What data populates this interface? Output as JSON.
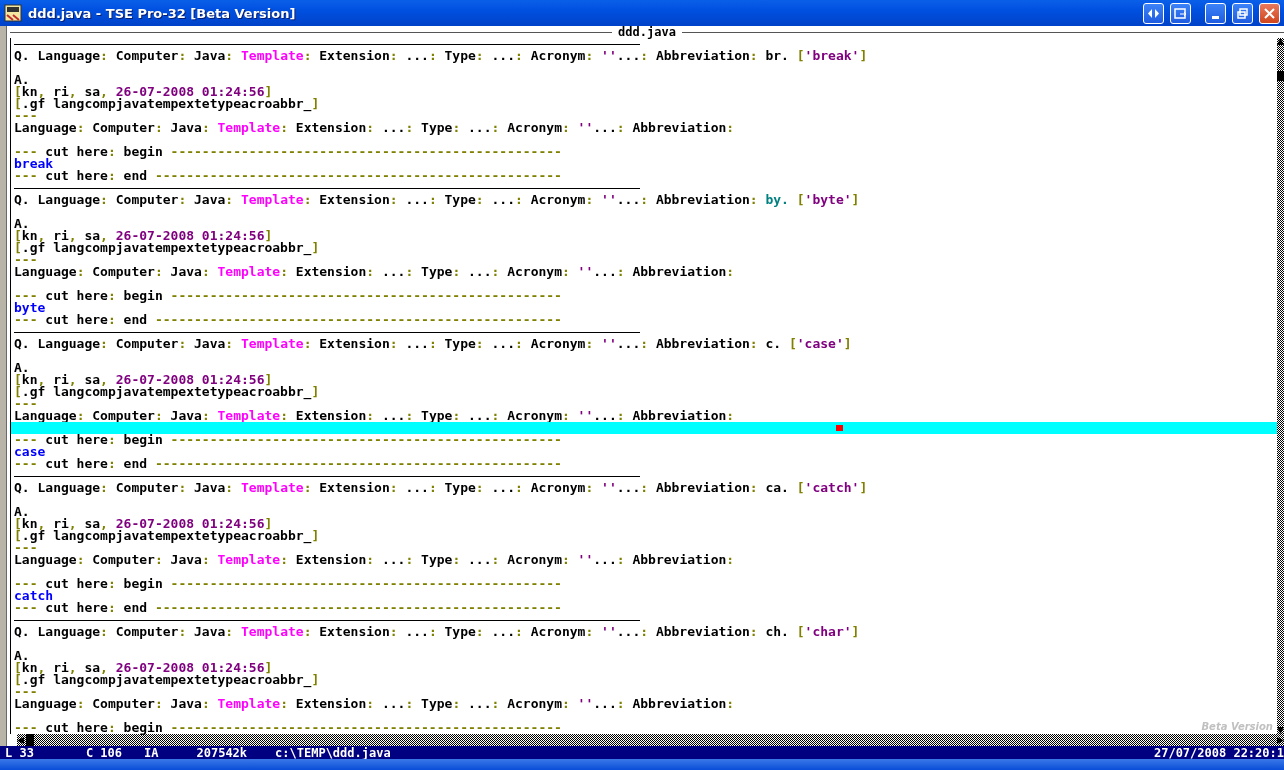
{
  "window": {
    "title": "ddd.java - TSE Pro-32 [Beta Version]"
  },
  "editor": {
    "file_tab": "ddd.java",
    "beta_label": "Beta Version",
    "lines": [
      {
        "kind": "rule"
      },
      {
        "kind": "text",
        "spans": [
          {
            "kind": "plain",
            "text": "Q. Language"
          },
          {
            "kind": "punct",
            "text": ":"
          },
          {
            "kind": "plain",
            "text": " Computer"
          },
          {
            "kind": "punct",
            "text": ":"
          },
          {
            "kind": "plain",
            "text": " Java"
          },
          {
            "kind": "punct",
            "text": ":"
          },
          {
            "kind": "magenta",
            "text": " Template"
          },
          {
            "kind": "punct",
            "text": ":"
          },
          {
            "kind": "plain",
            "text": " Extension"
          },
          {
            "kind": "punct",
            "text": ":"
          },
          {
            "kind": "plain",
            "text": " ..."
          },
          {
            "kind": "punct",
            "text": ":"
          },
          {
            "kind": "plain",
            "text": " Type"
          },
          {
            "kind": "punct",
            "text": ":"
          },
          {
            "kind": "plain",
            "text": " ..."
          },
          {
            "kind": "punct",
            "text": ":"
          },
          {
            "kind": "plain",
            "text": " Acronym"
          },
          {
            "kind": "punct",
            "text": ":"
          },
          {
            "kind": "purple",
            "text": " ''"
          },
          {
            "kind": "plain",
            "text": "..."
          },
          {
            "kind": "punct",
            "text": ":"
          },
          {
            "kind": "plain",
            "text": " Abbreviation"
          },
          {
            "kind": "punct",
            "text": ":"
          },
          {
            "kind": "plain",
            "text": " br."
          },
          {
            "kind": "punct",
            "text": " ["
          },
          {
            "kind": "purple",
            "text": "'break'"
          },
          {
            "kind": "punct",
            "text": "]"
          }
        ]
      },
      {
        "kind": "blank"
      },
      {
        "kind": "text",
        "spans": [
          {
            "kind": "plain",
            "text": "A."
          }
        ]
      },
      {
        "kind": "text",
        "spans": [
          {
            "kind": "punct",
            "text": "["
          },
          {
            "kind": "plain",
            "text": "kn"
          },
          {
            "kind": "punct",
            "text": ","
          },
          {
            "kind": "plain",
            "text": " ri"
          },
          {
            "kind": "punct",
            "text": ","
          },
          {
            "kind": "plain",
            "text": " sa"
          },
          {
            "kind": "punct",
            "text": ","
          },
          {
            "kind": "purple",
            "text": " 26-07-2008 01:24:56"
          },
          {
            "kind": "punct",
            "text": "]"
          }
        ]
      },
      {
        "kind": "text",
        "spans": [
          {
            "kind": "punct",
            "text": "["
          },
          {
            "kind": "plain",
            "text": ".gf langcompjavatempextetypeacroabbr_"
          },
          {
            "kind": "punct",
            "text": "]"
          }
        ]
      },
      {
        "kind": "text",
        "spans": [
          {
            "kind": "punct",
            "text": "---"
          }
        ]
      },
      {
        "kind": "text",
        "spans": [
          {
            "kind": "plain",
            "text": "Language"
          },
          {
            "kind": "punct",
            "text": ":"
          },
          {
            "kind": "plain",
            "text": " Computer"
          },
          {
            "kind": "punct",
            "text": ":"
          },
          {
            "kind": "plain",
            "text": " Java"
          },
          {
            "kind": "punct",
            "text": ":"
          },
          {
            "kind": "magenta",
            "text": " Template"
          },
          {
            "kind": "punct",
            "text": ":"
          },
          {
            "kind": "plain",
            "text": " Extension"
          },
          {
            "kind": "punct",
            "text": ":"
          },
          {
            "kind": "plain",
            "text": " ..."
          },
          {
            "kind": "punct",
            "text": ":"
          },
          {
            "kind": "plain",
            "text": " Type"
          },
          {
            "kind": "punct",
            "text": ":"
          },
          {
            "kind": "plain",
            "text": " ..."
          },
          {
            "kind": "punct",
            "text": ":"
          },
          {
            "kind": "plain",
            "text": " Acronym"
          },
          {
            "kind": "punct",
            "text": ":"
          },
          {
            "kind": "purple",
            "text": " ''"
          },
          {
            "kind": "plain",
            "text": "..."
          },
          {
            "kind": "punct",
            "text": ":"
          },
          {
            "kind": "plain",
            "text": " Abbreviation"
          },
          {
            "kind": "punct",
            "text": ":"
          }
        ]
      },
      {
        "kind": "blank"
      },
      {
        "kind": "text",
        "spans": [
          {
            "kind": "punct",
            "text": "---"
          },
          {
            "kind": "plain",
            "text": " cut here"
          },
          {
            "kind": "punct",
            "text": ":"
          },
          {
            "kind": "plain",
            "text": " begin"
          },
          {
            "kind": "punct",
            "text": " --------------------------------------------------"
          }
        ]
      },
      {
        "kind": "text",
        "spans": [
          {
            "kind": "keyword",
            "text": "break"
          }
        ]
      },
      {
        "kind": "text",
        "spans": [
          {
            "kind": "punct",
            "text": "---"
          },
          {
            "kind": "plain",
            "text": " cut here"
          },
          {
            "kind": "punct",
            "text": ":"
          },
          {
            "kind": "plain",
            "text": " end"
          },
          {
            "kind": "punct",
            "text": " ----------------------------------------------------"
          }
        ]
      },
      {
        "kind": "rule"
      },
      {
        "kind": "text",
        "spans": [
          {
            "kind": "plain",
            "text": "Q. Language"
          },
          {
            "kind": "punct",
            "text": ":"
          },
          {
            "kind": "plain",
            "text": " Computer"
          },
          {
            "kind": "punct",
            "text": ":"
          },
          {
            "kind": "plain",
            "text": " Java"
          },
          {
            "kind": "punct",
            "text": ":"
          },
          {
            "kind": "magenta",
            "text": " Template"
          },
          {
            "kind": "punct",
            "text": ":"
          },
          {
            "kind": "plain",
            "text": " Extension"
          },
          {
            "kind": "punct",
            "text": ":"
          },
          {
            "kind": "plain",
            "text": " ..."
          },
          {
            "kind": "punct",
            "text": ":"
          },
          {
            "kind": "plain",
            "text": " Type"
          },
          {
            "kind": "punct",
            "text": ":"
          },
          {
            "kind": "plain",
            "text": " ..."
          },
          {
            "kind": "punct",
            "text": ":"
          },
          {
            "kind": "plain",
            "text": " Acronym"
          },
          {
            "kind": "punct",
            "text": ":"
          },
          {
            "kind": "purple",
            "text": " ''"
          },
          {
            "kind": "plain",
            "text": "..."
          },
          {
            "kind": "punct",
            "text": ":"
          },
          {
            "kind": "plain",
            "text": " Abbreviation"
          },
          {
            "kind": "punct",
            "text": ":"
          },
          {
            "kind": "teal",
            "text": " by."
          },
          {
            "kind": "punct",
            "text": " ["
          },
          {
            "kind": "purple",
            "text": "'byte'"
          },
          {
            "kind": "punct",
            "text": "]"
          }
        ]
      },
      {
        "kind": "blank"
      },
      {
        "kind": "text",
        "spans": [
          {
            "kind": "plain",
            "text": "A."
          }
        ]
      },
      {
        "kind": "text",
        "spans": [
          {
            "kind": "punct",
            "text": "["
          },
          {
            "kind": "plain",
            "text": "kn"
          },
          {
            "kind": "punct",
            "text": ","
          },
          {
            "kind": "plain",
            "text": " ri"
          },
          {
            "kind": "punct",
            "text": ","
          },
          {
            "kind": "plain",
            "text": " sa"
          },
          {
            "kind": "punct",
            "text": ","
          },
          {
            "kind": "purple",
            "text": " 26-07-2008 01:24:56"
          },
          {
            "kind": "punct",
            "text": "]"
          }
        ]
      },
      {
        "kind": "text",
        "spans": [
          {
            "kind": "punct",
            "text": "["
          },
          {
            "kind": "plain",
            "text": ".gf langcompjavatempextetypeacroabbr_"
          },
          {
            "kind": "punct",
            "text": "]"
          }
        ]
      },
      {
        "kind": "text",
        "spans": [
          {
            "kind": "punct",
            "text": "---"
          }
        ]
      },
      {
        "kind": "text",
        "spans": [
          {
            "kind": "plain",
            "text": "Language"
          },
          {
            "kind": "punct",
            "text": ":"
          },
          {
            "kind": "plain",
            "text": " Computer"
          },
          {
            "kind": "punct",
            "text": ":"
          },
          {
            "kind": "plain",
            "text": " Java"
          },
          {
            "kind": "punct",
            "text": ":"
          },
          {
            "kind": "magenta",
            "text": " Template"
          },
          {
            "kind": "punct",
            "text": ":"
          },
          {
            "kind": "plain",
            "text": " Extension"
          },
          {
            "kind": "punct",
            "text": ":"
          },
          {
            "kind": "plain",
            "text": " ..."
          },
          {
            "kind": "punct",
            "text": ":"
          },
          {
            "kind": "plain",
            "text": " Type"
          },
          {
            "kind": "punct",
            "text": ":"
          },
          {
            "kind": "plain",
            "text": " ..."
          },
          {
            "kind": "punct",
            "text": ":"
          },
          {
            "kind": "plain",
            "text": " Acronym"
          },
          {
            "kind": "punct",
            "text": ":"
          },
          {
            "kind": "purple",
            "text": " ''"
          },
          {
            "kind": "plain",
            "text": "..."
          },
          {
            "kind": "punct",
            "text": ":"
          },
          {
            "kind": "plain",
            "text": " Abbreviation"
          },
          {
            "kind": "punct",
            "text": ":"
          }
        ]
      },
      {
        "kind": "blank"
      },
      {
        "kind": "text",
        "spans": [
          {
            "kind": "punct",
            "text": "---"
          },
          {
            "kind": "plain",
            "text": " cut here"
          },
          {
            "kind": "punct",
            "text": ":"
          },
          {
            "kind": "plain",
            "text": " begin"
          },
          {
            "kind": "punct",
            "text": " --------------------------------------------------"
          }
        ]
      },
      {
        "kind": "text",
        "spans": [
          {
            "kind": "keyword",
            "text": "byte"
          }
        ]
      },
      {
        "kind": "text",
        "spans": [
          {
            "kind": "punct",
            "text": "---"
          },
          {
            "kind": "plain",
            "text": " cut here"
          },
          {
            "kind": "punct",
            "text": ":"
          },
          {
            "kind": "plain",
            "text": " end"
          },
          {
            "kind": "punct",
            "text": " ----------------------------------------------------"
          }
        ]
      },
      {
        "kind": "rule"
      },
      {
        "kind": "text",
        "spans": [
          {
            "kind": "plain",
            "text": "Q. Language"
          },
          {
            "kind": "punct",
            "text": ":"
          },
          {
            "kind": "plain",
            "text": " Computer"
          },
          {
            "kind": "punct",
            "text": ":"
          },
          {
            "kind": "plain",
            "text": " Java"
          },
          {
            "kind": "punct",
            "text": ":"
          },
          {
            "kind": "magenta",
            "text": " Template"
          },
          {
            "kind": "punct",
            "text": ":"
          },
          {
            "kind": "plain",
            "text": " Extension"
          },
          {
            "kind": "punct",
            "text": ":"
          },
          {
            "kind": "plain",
            "text": " ..."
          },
          {
            "kind": "punct",
            "text": ":"
          },
          {
            "kind": "plain",
            "text": " Type"
          },
          {
            "kind": "punct",
            "text": ":"
          },
          {
            "kind": "plain",
            "text": " ..."
          },
          {
            "kind": "punct",
            "text": ":"
          },
          {
            "kind": "plain",
            "text": " Acronym"
          },
          {
            "kind": "punct",
            "text": ":"
          },
          {
            "kind": "purple",
            "text": " ''"
          },
          {
            "kind": "plain",
            "text": "..."
          },
          {
            "kind": "punct",
            "text": ":"
          },
          {
            "kind": "plain",
            "text": " Abbreviation"
          },
          {
            "kind": "punct",
            "text": ":"
          },
          {
            "kind": "plain",
            "text": " c."
          },
          {
            "kind": "punct",
            "text": " ["
          },
          {
            "kind": "purple",
            "text": "'case'"
          },
          {
            "kind": "punct",
            "text": "]"
          }
        ]
      },
      {
        "kind": "blank"
      },
      {
        "kind": "text",
        "spans": [
          {
            "kind": "plain",
            "text": "A."
          }
        ]
      },
      {
        "kind": "text",
        "spans": [
          {
            "kind": "punct",
            "text": "["
          },
          {
            "kind": "plain",
            "text": "kn"
          },
          {
            "kind": "punct",
            "text": ","
          },
          {
            "kind": "plain",
            "text": " ri"
          },
          {
            "kind": "punct",
            "text": ","
          },
          {
            "kind": "plain",
            "text": " sa"
          },
          {
            "kind": "punct",
            "text": ","
          },
          {
            "kind": "purple",
            "text": " 26-07-2008 01:24:56"
          },
          {
            "kind": "punct",
            "text": "]"
          }
        ]
      },
      {
        "kind": "text",
        "spans": [
          {
            "kind": "punct",
            "text": "["
          },
          {
            "kind": "plain",
            "text": ".gf langcompjavatempextetypeacroabbr_"
          },
          {
            "kind": "punct",
            "text": "]"
          }
        ]
      },
      {
        "kind": "text",
        "spans": [
          {
            "kind": "punct",
            "text": "---"
          }
        ]
      },
      {
        "kind": "text",
        "spans": [
          {
            "kind": "plain",
            "text": "Language"
          },
          {
            "kind": "punct",
            "text": ":"
          },
          {
            "kind": "plain",
            "text": " Computer"
          },
          {
            "kind": "punct",
            "text": ":"
          },
          {
            "kind": "plain",
            "text": " Java"
          },
          {
            "kind": "punct",
            "text": ":"
          },
          {
            "kind": "magenta",
            "text": " Template"
          },
          {
            "kind": "punct",
            "text": ":"
          },
          {
            "kind": "plain",
            "text": " Extension"
          },
          {
            "kind": "punct",
            "text": ":"
          },
          {
            "kind": "plain",
            "text": " ..."
          },
          {
            "kind": "punct",
            "text": ":"
          },
          {
            "kind": "plain",
            "text": " Type"
          },
          {
            "kind": "punct",
            "text": ":"
          },
          {
            "kind": "plain",
            "text": " ..."
          },
          {
            "kind": "punct",
            "text": ":"
          },
          {
            "kind": "plain",
            "text": " Acronym"
          },
          {
            "kind": "punct",
            "text": ":"
          },
          {
            "kind": "purple",
            "text": " ''"
          },
          {
            "kind": "plain",
            "text": "..."
          },
          {
            "kind": "punct",
            "text": ":"
          },
          {
            "kind": "plain",
            "text": " Abbreviation"
          },
          {
            "kind": "punct",
            "text": ":"
          }
        ]
      },
      {
        "kind": "cursor"
      },
      {
        "kind": "text",
        "spans": [
          {
            "kind": "punct",
            "text": "---"
          },
          {
            "kind": "plain",
            "text": " cut here"
          },
          {
            "kind": "punct",
            "text": ":"
          },
          {
            "kind": "plain",
            "text": " begin"
          },
          {
            "kind": "punct",
            "text": " --------------------------------------------------"
          }
        ]
      },
      {
        "kind": "text",
        "spans": [
          {
            "kind": "keyword",
            "text": "case"
          }
        ]
      },
      {
        "kind": "text",
        "spans": [
          {
            "kind": "punct",
            "text": "---"
          },
          {
            "kind": "plain",
            "text": " cut here"
          },
          {
            "kind": "punct",
            "text": ":"
          },
          {
            "kind": "plain",
            "text": " end"
          },
          {
            "kind": "punct",
            "text": " ----------------------------------------------------"
          }
        ]
      },
      {
        "kind": "rule"
      },
      {
        "kind": "text",
        "spans": [
          {
            "kind": "plain",
            "text": "Q. Language"
          },
          {
            "kind": "punct",
            "text": ":"
          },
          {
            "kind": "plain",
            "text": " Computer"
          },
          {
            "kind": "punct",
            "text": ":"
          },
          {
            "kind": "plain",
            "text": " Java"
          },
          {
            "kind": "punct",
            "text": ":"
          },
          {
            "kind": "magenta",
            "text": " Template"
          },
          {
            "kind": "punct",
            "text": ":"
          },
          {
            "kind": "plain",
            "text": " Extension"
          },
          {
            "kind": "punct",
            "text": ":"
          },
          {
            "kind": "plain",
            "text": " ..."
          },
          {
            "kind": "punct",
            "text": ":"
          },
          {
            "kind": "plain",
            "text": " Type"
          },
          {
            "kind": "punct",
            "text": ":"
          },
          {
            "kind": "plain",
            "text": " ..."
          },
          {
            "kind": "punct",
            "text": ":"
          },
          {
            "kind": "plain",
            "text": " Acronym"
          },
          {
            "kind": "punct",
            "text": ":"
          },
          {
            "kind": "purple",
            "text": " ''"
          },
          {
            "kind": "plain",
            "text": "..."
          },
          {
            "kind": "punct",
            "text": ":"
          },
          {
            "kind": "plain",
            "text": " Abbreviation"
          },
          {
            "kind": "punct",
            "text": ":"
          },
          {
            "kind": "plain",
            "text": " ca."
          },
          {
            "kind": "punct",
            "text": " ["
          },
          {
            "kind": "purple",
            "text": "'catch'"
          },
          {
            "kind": "punct",
            "text": "]"
          }
        ]
      },
      {
        "kind": "blank"
      },
      {
        "kind": "text",
        "spans": [
          {
            "kind": "plain",
            "text": "A."
          }
        ]
      },
      {
        "kind": "text",
        "spans": [
          {
            "kind": "punct",
            "text": "["
          },
          {
            "kind": "plain",
            "text": "kn"
          },
          {
            "kind": "punct",
            "text": ","
          },
          {
            "kind": "plain",
            "text": " ri"
          },
          {
            "kind": "punct",
            "text": ","
          },
          {
            "kind": "plain",
            "text": " sa"
          },
          {
            "kind": "punct",
            "text": ","
          },
          {
            "kind": "purple",
            "text": " 26-07-2008 01:24:56"
          },
          {
            "kind": "punct",
            "text": "]"
          }
        ]
      },
      {
        "kind": "text",
        "spans": [
          {
            "kind": "punct",
            "text": "["
          },
          {
            "kind": "plain",
            "text": ".gf langcompjavatempextetypeacroabbr_"
          },
          {
            "kind": "punct",
            "text": "]"
          }
        ]
      },
      {
        "kind": "text",
        "spans": [
          {
            "kind": "punct",
            "text": "---"
          }
        ]
      },
      {
        "kind": "text",
        "spans": [
          {
            "kind": "plain",
            "text": "Language"
          },
          {
            "kind": "punct",
            "text": ":"
          },
          {
            "kind": "plain",
            "text": " Computer"
          },
          {
            "kind": "punct",
            "text": ":"
          },
          {
            "kind": "plain",
            "text": " Java"
          },
          {
            "kind": "punct",
            "text": ":"
          },
          {
            "kind": "magenta",
            "text": " Template"
          },
          {
            "kind": "punct",
            "text": ":"
          },
          {
            "kind": "plain",
            "text": " Extension"
          },
          {
            "kind": "punct",
            "text": ":"
          },
          {
            "kind": "plain",
            "text": " ..."
          },
          {
            "kind": "punct",
            "text": ":"
          },
          {
            "kind": "plain",
            "text": " Type"
          },
          {
            "kind": "punct",
            "text": ":"
          },
          {
            "kind": "plain",
            "text": " ..."
          },
          {
            "kind": "punct",
            "text": ":"
          },
          {
            "kind": "plain",
            "text": " Acronym"
          },
          {
            "kind": "punct",
            "text": ":"
          },
          {
            "kind": "purple",
            "text": " ''"
          },
          {
            "kind": "plain",
            "text": "..."
          },
          {
            "kind": "punct",
            "text": ":"
          },
          {
            "kind": "plain",
            "text": " Abbreviation"
          },
          {
            "kind": "punct",
            "text": ":"
          }
        ]
      },
      {
        "kind": "blank"
      },
      {
        "kind": "text",
        "spans": [
          {
            "kind": "punct",
            "text": "---"
          },
          {
            "kind": "plain",
            "text": " cut here"
          },
          {
            "kind": "punct",
            "text": ":"
          },
          {
            "kind": "plain",
            "text": " begin"
          },
          {
            "kind": "punct",
            "text": " --------------------------------------------------"
          }
        ]
      },
      {
        "kind": "text",
        "spans": [
          {
            "kind": "keyword",
            "text": "catch"
          }
        ]
      },
      {
        "kind": "text",
        "spans": [
          {
            "kind": "punct",
            "text": "---"
          },
          {
            "kind": "plain",
            "text": " cut here"
          },
          {
            "kind": "punct",
            "text": ":"
          },
          {
            "kind": "plain",
            "text": " end"
          },
          {
            "kind": "punct",
            "text": " ----------------------------------------------------"
          }
        ]
      },
      {
        "kind": "rule"
      },
      {
        "kind": "text",
        "spans": [
          {
            "kind": "plain",
            "text": "Q. Language"
          },
          {
            "kind": "punct",
            "text": ":"
          },
          {
            "kind": "plain",
            "text": " Computer"
          },
          {
            "kind": "punct",
            "text": ":"
          },
          {
            "kind": "plain",
            "text": " Java"
          },
          {
            "kind": "punct",
            "text": ":"
          },
          {
            "kind": "magenta",
            "text": " Template"
          },
          {
            "kind": "punct",
            "text": ":"
          },
          {
            "kind": "plain",
            "text": " Extension"
          },
          {
            "kind": "punct",
            "text": ":"
          },
          {
            "kind": "plain",
            "text": " ..."
          },
          {
            "kind": "punct",
            "text": ":"
          },
          {
            "kind": "plain",
            "text": " Type"
          },
          {
            "kind": "punct",
            "text": ":"
          },
          {
            "kind": "plain",
            "text": " ..."
          },
          {
            "kind": "punct",
            "text": ":"
          },
          {
            "kind": "plain",
            "text": " Acronym"
          },
          {
            "kind": "punct",
            "text": ":"
          },
          {
            "kind": "purple",
            "text": " ''"
          },
          {
            "kind": "plain",
            "text": "..."
          },
          {
            "kind": "punct",
            "text": ":"
          },
          {
            "kind": "plain",
            "text": " Abbreviation"
          },
          {
            "kind": "punct",
            "text": ":"
          },
          {
            "kind": "plain",
            "text": " ch."
          },
          {
            "kind": "punct",
            "text": " ["
          },
          {
            "kind": "purple",
            "text": "'char'"
          },
          {
            "kind": "punct",
            "text": "]"
          }
        ]
      },
      {
        "kind": "blank"
      },
      {
        "kind": "text",
        "spans": [
          {
            "kind": "plain",
            "text": "A."
          }
        ]
      },
      {
        "kind": "text",
        "spans": [
          {
            "kind": "punct",
            "text": "["
          },
          {
            "kind": "plain",
            "text": "kn"
          },
          {
            "kind": "punct",
            "text": ","
          },
          {
            "kind": "plain",
            "text": " ri"
          },
          {
            "kind": "punct",
            "text": ","
          },
          {
            "kind": "plain",
            "text": " sa"
          },
          {
            "kind": "punct",
            "text": ","
          },
          {
            "kind": "purple",
            "text": " 26-07-2008 01:24:56"
          },
          {
            "kind": "punct",
            "text": "]"
          }
        ]
      },
      {
        "kind": "text",
        "spans": [
          {
            "kind": "punct",
            "text": "["
          },
          {
            "kind": "plain",
            "text": ".gf langcompjavatempextetypeacroabbr_"
          },
          {
            "kind": "punct",
            "text": "]"
          }
        ]
      },
      {
        "kind": "text",
        "spans": [
          {
            "kind": "punct",
            "text": "---"
          }
        ]
      },
      {
        "kind": "text",
        "spans": [
          {
            "kind": "plain",
            "text": "Language"
          },
          {
            "kind": "punct",
            "text": ":"
          },
          {
            "kind": "plain",
            "text": " Computer"
          },
          {
            "kind": "punct",
            "text": ":"
          },
          {
            "kind": "plain",
            "text": " Java"
          },
          {
            "kind": "punct",
            "text": ":"
          },
          {
            "kind": "magenta",
            "text": " Template"
          },
          {
            "kind": "punct",
            "text": ":"
          },
          {
            "kind": "plain",
            "text": " Extension"
          },
          {
            "kind": "punct",
            "text": ":"
          },
          {
            "kind": "plain",
            "text": " ..."
          },
          {
            "kind": "punct",
            "text": ":"
          },
          {
            "kind": "plain",
            "text": " Type"
          },
          {
            "kind": "punct",
            "text": ":"
          },
          {
            "kind": "plain",
            "text": " ..."
          },
          {
            "kind": "punct",
            "text": ":"
          },
          {
            "kind": "plain",
            "text": " Acronym"
          },
          {
            "kind": "punct",
            "text": ":"
          },
          {
            "kind": "purple",
            "text": " ''"
          },
          {
            "kind": "plain",
            "text": "..."
          },
          {
            "kind": "punct",
            "text": ":"
          },
          {
            "kind": "plain",
            "text": " Abbreviation"
          },
          {
            "kind": "punct",
            "text": ":"
          }
        ]
      },
      {
        "kind": "blank"
      },
      {
        "kind": "text",
        "spans": [
          {
            "kind": "punct",
            "text": "---"
          },
          {
            "kind": "plain",
            "text": " cut here"
          },
          {
            "kind": "punct",
            "text": ":"
          },
          {
            "kind": "plain",
            "text": " begin"
          },
          {
            "kind": "punct",
            "text": " --------------------------------------------------"
          }
        ]
      }
    ]
  },
  "status_bar": {
    "fields": [
      "L 33",
      "C 106",
      "IA",
      "207542k",
      "c:\\TEMP\\ddd.java"
    ],
    "clock": "27/07/2008 22:20:1"
  }
}
